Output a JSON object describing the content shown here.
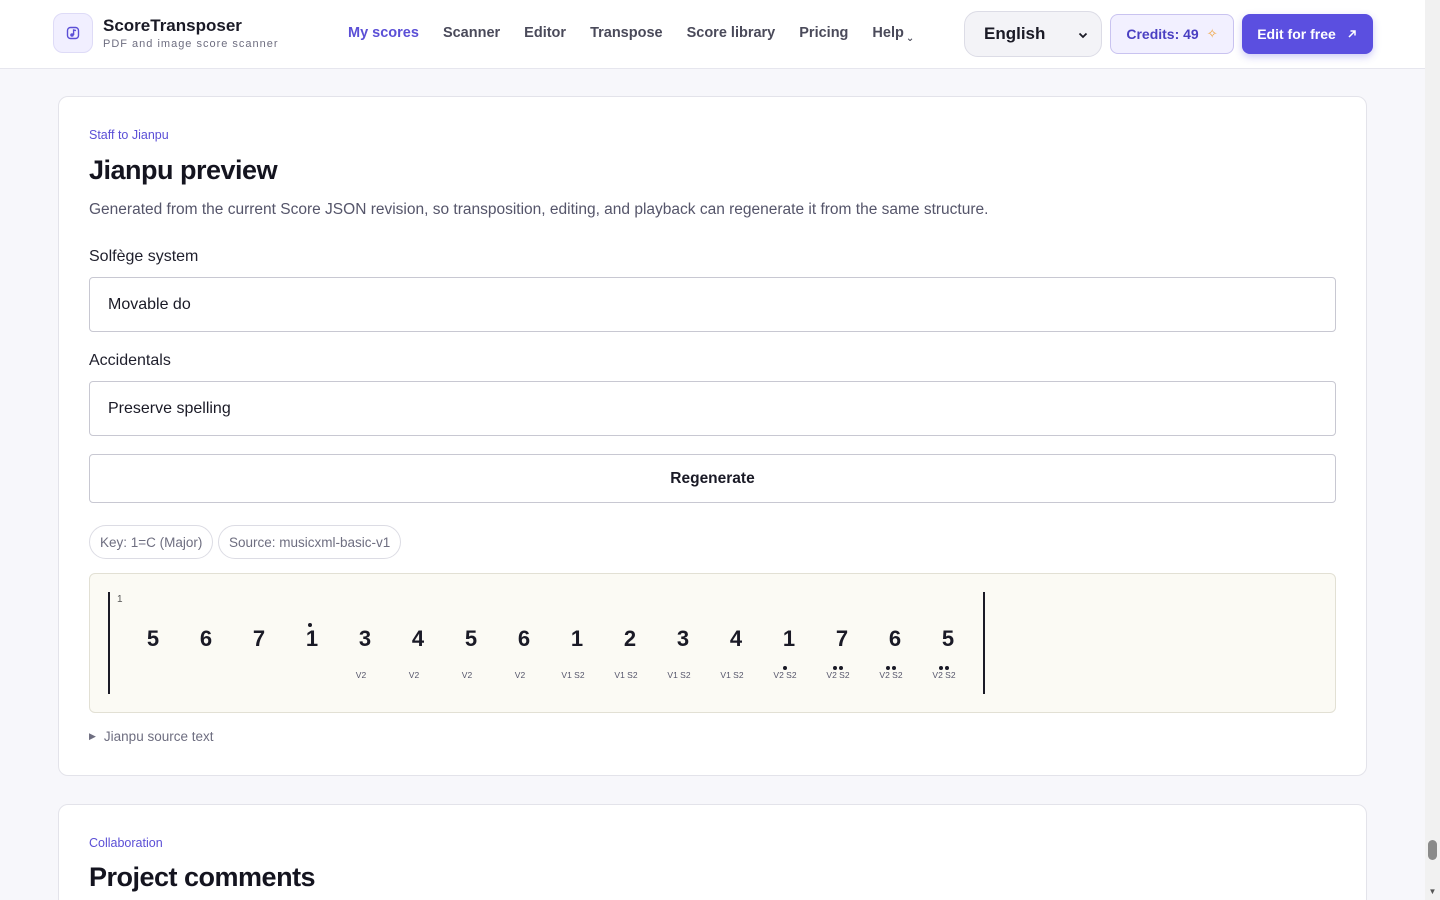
{
  "header": {
    "brand_name": "ScoreTransposer",
    "brand_tagline": "PDF and image score scanner",
    "nav": [
      {
        "label": "My scores",
        "active": true
      },
      {
        "label": "Scanner",
        "active": false
      },
      {
        "label": "Editor",
        "active": false
      },
      {
        "label": "Transpose",
        "active": false
      },
      {
        "label": "Score library",
        "active": false
      },
      {
        "label": "Pricing",
        "active": false
      },
      {
        "label": "Help",
        "active": false
      }
    ],
    "language": "English",
    "credits_label": "Credits: 49",
    "edit_button": "Edit for free",
    "accent": "#5b4fe0"
  },
  "jianpu_card": {
    "eyebrow": "Staff to Jianpu",
    "title": "Jianpu preview",
    "description": "Generated from the current Score JSON revision, so transposition, editing, and playback can regenerate it from the same structure.",
    "solfege_label": "Solfège system",
    "solfege_value": "Movable do",
    "accidentals_label": "Accidentals",
    "accidentals_value": "Preserve spelling",
    "regenerate_button": "Regenerate",
    "chips": [
      "Key: 1=C (Major)",
      "Source: musicxml-basic-v1"
    ],
    "measure_number": "1",
    "notes": [
      {
        "digit": "5",
        "sub": "",
        "dots_above": 0,
        "dots_below": 0
      },
      {
        "digit": "6",
        "sub": "",
        "dots_above": 0,
        "dots_below": 0
      },
      {
        "digit": "7",
        "sub": "",
        "dots_above": 0,
        "dots_below": 0
      },
      {
        "digit": "1",
        "sub": "",
        "dots_above": 1,
        "dots_below": 0
      },
      {
        "digit": "3",
        "sub": "V2",
        "dots_above": 0,
        "dots_below": 0
      },
      {
        "digit": "4",
        "sub": "V2",
        "dots_above": 0,
        "dots_below": 0
      },
      {
        "digit": "5",
        "sub": "V2",
        "dots_above": 0,
        "dots_below": 0
      },
      {
        "digit": "6",
        "sub": "V2",
        "dots_above": 0,
        "dots_below": 0
      },
      {
        "digit": "1",
        "sub": "V1 S2",
        "dots_above": 0,
        "dots_below": 0
      },
      {
        "digit": "2",
        "sub": "V1 S2",
        "dots_above": 0,
        "dots_below": 0
      },
      {
        "digit": "3",
        "sub": "V1 S2",
        "dots_above": 0,
        "dots_below": 0
      },
      {
        "digit": "4",
        "sub": "V1 S2",
        "dots_above": 0,
        "dots_below": 0
      },
      {
        "digit": "1",
        "sub": "V2 S2",
        "dots_above": 0,
        "dots_below": 1
      },
      {
        "digit": "7",
        "sub": "V2 S2",
        "dots_above": 0,
        "dots_below": 2
      },
      {
        "digit": "6",
        "sub": "V2 S2",
        "dots_above": 0,
        "dots_below": 2
      },
      {
        "digit": "5",
        "sub": "V2 S2",
        "dots_above": 0,
        "dots_below": 2
      }
    ],
    "source_toggle": "Jianpu source text"
  },
  "comments_card": {
    "eyebrow": "Collaboration",
    "title": "Project comments"
  }
}
